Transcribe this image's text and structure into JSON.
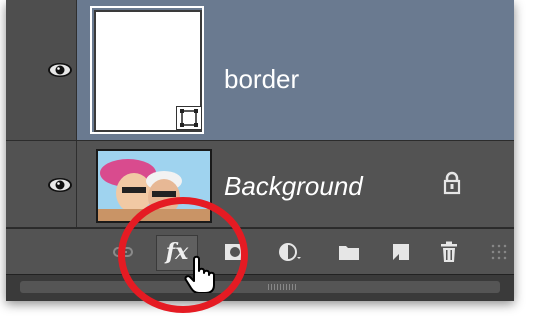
{
  "layers": [
    {
      "name": "border",
      "selected": true,
      "visible": true,
      "has_mask": true
    },
    {
      "name": "Background",
      "selected": false,
      "visible": true,
      "locked": true
    }
  ],
  "footer_buttons": [
    {
      "icon": "link-layers-icon"
    },
    {
      "icon": "fx-icon",
      "label": "fx"
    },
    {
      "icon": "add-mask-icon"
    },
    {
      "icon": "adjustment-layer-icon"
    },
    {
      "icon": "new-group-icon"
    },
    {
      "icon": "new-layer-icon"
    },
    {
      "icon": "trash-icon"
    }
  ],
  "colors": {
    "selected_row": "#6a7a90",
    "panel_bg": "#535353",
    "highlight_circle": "#e51b23"
  }
}
